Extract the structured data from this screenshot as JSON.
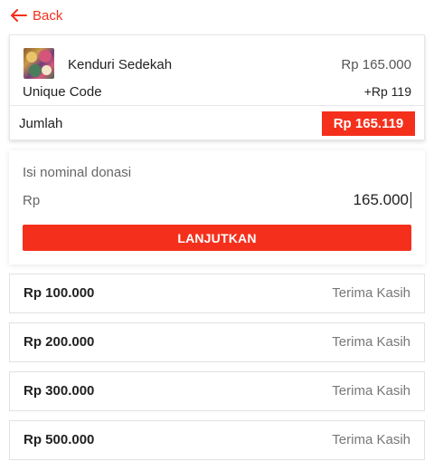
{
  "nav": {
    "back_label": "Back",
    "back_icon": "arrow-left-icon"
  },
  "summary": {
    "product_name": "Kenduri Sedekah",
    "product_price": "Rp 165.000",
    "unique_code_label": "Unique Code",
    "unique_code_value": "+Rp 119",
    "total_label": "Jumlah",
    "total_value": "Rp 165.119"
  },
  "donation_input": {
    "title": "Isi nominal donasi",
    "currency": "Rp",
    "value": "165.000",
    "submit_label": "LANJUTKAN"
  },
  "presets": [
    {
      "amount": "Rp 100.000",
      "note": "Terima Kasih"
    },
    {
      "amount": "Rp 200.000",
      "note": "Terima Kasih"
    },
    {
      "amount": "Rp 300.000",
      "note": "Terima Kasih"
    },
    {
      "amount": "Rp 500.000",
      "note": "Terima Kasih"
    }
  ],
  "colors": {
    "accent": "#f4301c",
    "border": "#e1e1e1",
    "muted_text": "#777777"
  }
}
